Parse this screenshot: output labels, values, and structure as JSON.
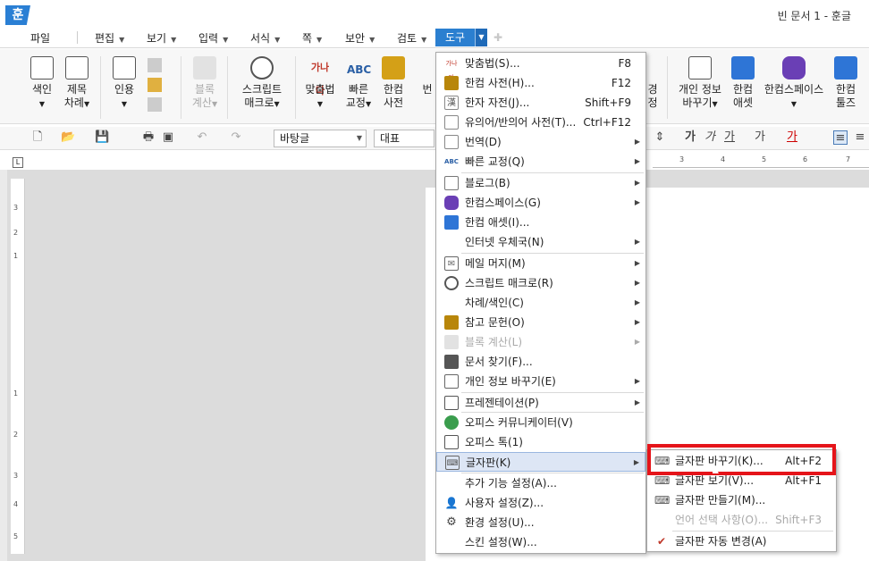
{
  "titlebar": {
    "logo": "훈",
    "doc_title": "빈 문서 1 - 훈글"
  },
  "menubar": {
    "file": "파일",
    "items": [
      "편집",
      "보기",
      "입력",
      "서식",
      "쪽",
      "보안",
      "검토"
    ],
    "active": "도구"
  },
  "ribbon": {
    "items": [
      {
        "label": "색인",
        "sub": "",
        "icon": "index-icon"
      },
      {
        "label": "제목",
        "sub": "차례",
        "icon": "toc-icon"
      },
      {
        "label": "인용",
        "sub": "",
        "icon": "citation-icon"
      },
      {
        "label": "블록",
        "sub": "계산",
        "icon": "block-calc-icon"
      },
      {
        "label": "스크립트",
        "sub": "매크로",
        "icon": "script-macro-icon"
      },
      {
        "label": "맞춤법",
        "sub": "",
        "icon": "spell-check-icon"
      },
      {
        "label": "빠른",
        "sub": "교정",
        "icon": "quick-correct-icon"
      },
      {
        "label": "한컴",
        "sub": "사전",
        "icon": "hancom-dictionary-icon"
      },
      {
        "label": "개인 정보",
        "sub": "바꾸기",
        "icon": "privacy-icon"
      },
      {
        "label": "한컴",
        "sub": "애셋",
        "icon": "hancom-asset-icon"
      },
      {
        "label": "한컴스페이스",
        "sub": "",
        "icon": "hancom-space-icon"
      },
      {
        "label": "한컴",
        "sub": "툴즈",
        "icon": "hancom-tools-icon"
      }
    ],
    "partial": [
      "번",
      "경",
      "정"
    ]
  },
  "toolbar2": {
    "style": "바탕글",
    "font": "대표",
    "bold": "가",
    "italic": "가",
    "underline": "가",
    "strike": "가",
    "color": "가"
  },
  "ruler": {
    "h": [
      "3",
      "4",
      "5",
      "6",
      "7"
    ],
    "v": [
      "3",
      "2",
      "1",
      "1",
      "2",
      "3",
      "4",
      "5"
    ]
  },
  "dropdown": {
    "items": [
      {
        "label": "맞춤법(S)...",
        "shortcut": "F8",
        "icon": "spell-check-icon",
        "color": "#c0392b",
        "sub": false,
        "disabled": false
      },
      {
        "label": "한컴 사전(H)...",
        "shortcut": "F12",
        "icon": "dictionary-icon",
        "color": "#b8860b",
        "sub": false,
        "disabled": false
      },
      {
        "label": "한자 자전(J)...",
        "shortcut": "Shift+F9",
        "icon": "hanja-icon",
        "color": "#888",
        "sub": false,
        "disabled": false
      },
      {
        "label": "유의어/반의어 사전(T)...",
        "shortcut": "Ctrl+F12",
        "icon": "thesaurus-icon",
        "color": "#888",
        "sub": false,
        "disabled": false
      },
      {
        "label": "번역(D)",
        "shortcut": "",
        "icon": "translate-icon",
        "color": "#666",
        "sub": true,
        "disabled": false,
        "sep_after": false
      },
      {
        "label": "빠른 교정(Q)",
        "shortcut": "",
        "icon": "quick-correct-icon",
        "color": "#e67e22",
        "sub": true,
        "disabled": false
      },
      {
        "label": "블로그(B)",
        "shortcut": "",
        "icon": "blog-icon",
        "color": "#777",
        "sub": true,
        "disabled": false
      },
      {
        "label": "한컴스페이스(G)",
        "shortcut": "",
        "icon": "hancom-space-icon",
        "color": "#6a3fb5",
        "sub": true,
        "disabled": false
      },
      {
        "label": "한컴 애셋(I)...",
        "shortcut": "",
        "icon": "hancom-asset-icon",
        "color": "#2e75d6",
        "sub": false,
        "disabled": false
      },
      {
        "label": "인터넷 우체국(N)",
        "shortcut": "",
        "icon": "",
        "color": "",
        "sub": true,
        "disabled": false
      },
      {
        "label": "메일 머지(M)",
        "shortcut": "",
        "icon": "mail-icon",
        "color": "#666",
        "sub": true,
        "disabled": false
      },
      {
        "label": "스크립트 매크로(R)",
        "shortcut": "",
        "icon": "script-macro-icon",
        "color": "#555",
        "sub": true,
        "disabled": false
      },
      {
        "label": "차례/색인(C)",
        "shortcut": "",
        "icon": "",
        "color": "",
        "sub": true,
        "disabled": false
      },
      {
        "label": "참고 문헌(O)",
        "shortcut": "",
        "icon": "reference-icon",
        "color": "#b8860b",
        "sub": true,
        "disabled": false
      },
      {
        "label": "블록 계산(L)",
        "shortcut": "",
        "icon": "block-calc-icon",
        "color": "#ccc",
        "sub": true,
        "disabled": true
      },
      {
        "label": "문서 찾기(F)...",
        "shortcut": "",
        "icon": "find-document-icon",
        "color": "#555",
        "sub": false,
        "disabled": false
      },
      {
        "label": "개인 정보 바꾸기(E)",
        "shortcut": "",
        "icon": "privacy-icon",
        "color": "#666",
        "sub": true,
        "disabled": false
      },
      {
        "label": "프레젠테이션(P)",
        "shortcut": "",
        "icon": "presentation-icon",
        "color": "#555",
        "sub": true,
        "disabled": false
      },
      {
        "label": "오피스 커뮤니케이터(V)",
        "shortcut": "",
        "icon": "communicator-icon",
        "color": "#3a9d4d",
        "sub": false,
        "disabled": false
      },
      {
        "label": "오피스 톡(1)",
        "shortcut": "",
        "icon": "office-talk-icon",
        "color": "#555",
        "sub": false,
        "disabled": false
      },
      {
        "label": "글자판(K)",
        "shortcut": "",
        "icon": "keyboard-icon",
        "color": "#666",
        "sub": true,
        "disabled": false,
        "highlight": true
      },
      {
        "label": "추가 기능 설정(A)...",
        "shortcut": "",
        "icon": "",
        "color": "",
        "sub": false,
        "disabled": false
      },
      {
        "label": "사용자 설정(Z)...",
        "shortcut": "",
        "icon": "user-settings-icon",
        "color": "#4a7bb7",
        "sub": false,
        "disabled": false
      },
      {
        "label": "환경 설정(U)...",
        "shortcut": "",
        "icon": "gear-icon",
        "color": "#444",
        "sub": false,
        "disabled": false
      },
      {
        "label": "스킨 설정(W)...",
        "shortcut": "",
        "icon": "",
        "color": "",
        "sub": false,
        "disabled": false
      }
    ]
  },
  "submenu": {
    "items": [
      {
        "label": "글자판 바꾸기(K)...",
        "shortcut": "Alt+F2",
        "icon": "keyboard-switch-icon",
        "disabled": false
      },
      {
        "label": "글자판 보기(V)...",
        "shortcut": "Alt+F1",
        "icon": "keyboard-view-icon",
        "disabled": false
      },
      {
        "label": "글자판 만들기(M)...",
        "shortcut": "",
        "icon": "keyboard-make-icon",
        "disabled": false
      },
      {
        "label": "언어 선택 사항(O)...",
        "shortcut": "Shift+F3",
        "icon": "",
        "disabled": true
      },
      {
        "label": "글자판 자동 변경(A)",
        "shortcut": "",
        "icon": "check-icon",
        "disabled": false
      }
    ]
  }
}
